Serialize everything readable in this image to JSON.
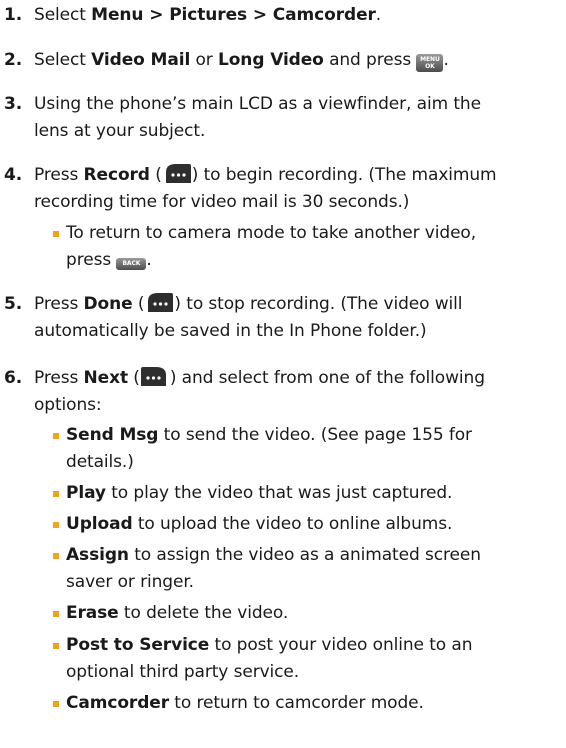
{
  "steps": [
    {
      "n": "1.",
      "t": {
        "a": "Select ",
        "b": "Menu > Pictures > Camcorder",
        "c": "."
      }
    },
    {
      "n": "2.",
      "t": {
        "a": "Select ",
        "b1": "Video Mail",
        "m": " or ",
        "b2": "Long Video",
        "c": " and press ",
        "d": "."
      }
    },
    {
      "n": "3.",
      "t": {
        "a": "Using the phone’s main LCD as a viewfinder, aim the",
        "a2": "lens at your subject."
      }
    },
    {
      "n": "4.",
      "t": {
        "a": "Press ",
        "b": "Record",
        "c": " (",
        "d": ") to begin recording. (The maximum",
        "e": "recording time for video mail is 30 seconds.)"
      }
    },
    {
      "n": "5.",
      "t": {
        "a": "Press ",
        "b": "Done",
        "c": " (",
        "d": ") to stop recording. (The video will",
        "e": "automatically be saved in the In Phone folder.)"
      }
    },
    {
      "n": "6.",
      "t": {
        "a": "Press ",
        "b": "Next",
        "c": " (",
        "d": ") and select from one of the following",
        "e": "options:"
      }
    }
  ],
  "step4_bullet": {
    "a": "To return to camera mode to take another video,",
    "b": "press ",
    "c": "."
  },
  "options": [
    {
      "label": "Send Msg",
      "text": " to send the video. (See page 155 for",
      "text2": "details.)"
    },
    {
      "label": "Play",
      "text": " to play the video that was just captured."
    },
    {
      "label": "Upload",
      "text": " to upload the video to online albums."
    },
    {
      "label": "Assign",
      "text": " to assign the video as a animated screen",
      "text2": "saver or ringer."
    },
    {
      "label": "Erase",
      "text": " to delete the video."
    },
    {
      "label": "Post to Service",
      "text": " to post your video online to an",
      "text2": "optional third party service."
    },
    {
      "label": "Camcorder",
      "text": " to return to camcorder mode."
    }
  ],
  "keys": {
    "menu_top": "MENU",
    "menu_bottom": "OK",
    "back": "BACK"
  },
  "icons": {
    "menu_key": "menu-ok-key-icon",
    "softkey": "softkey-ellipsis-icon",
    "back_key": "back-key-icon"
  },
  "colors": {
    "bullet": "#f2a31b",
    "text": "#1a1a1a"
  }
}
